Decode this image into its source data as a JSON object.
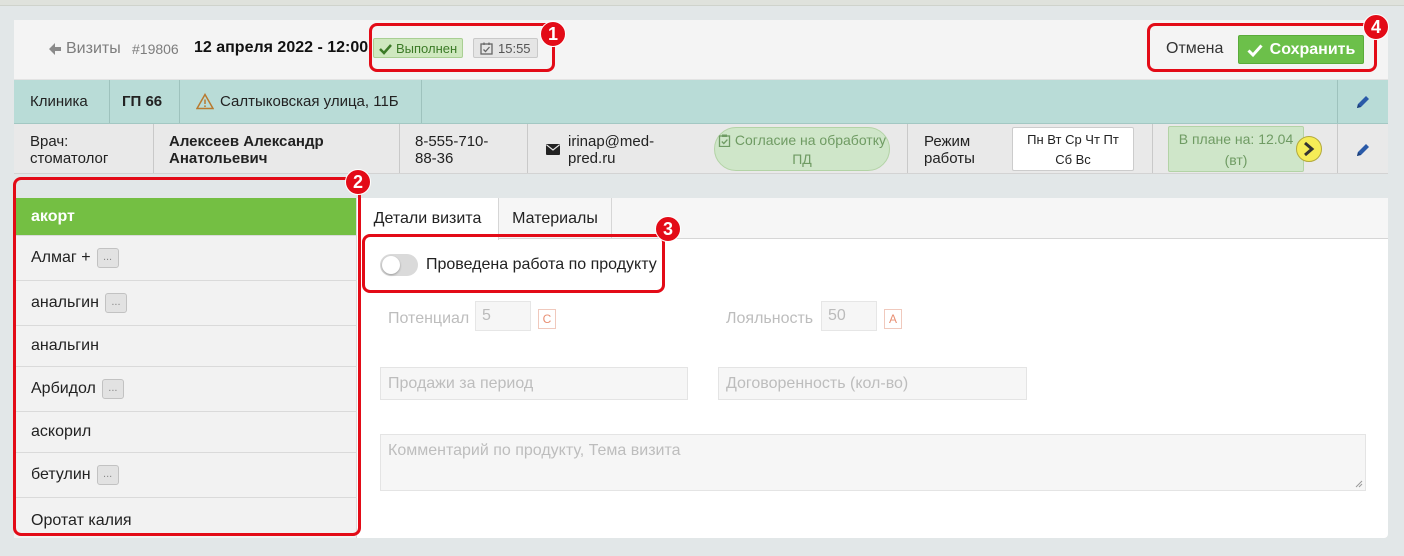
{
  "header": {
    "back_label": "Визиты",
    "visit_id": "#19806",
    "visit_date": "12 апреля 2022 - 12:00",
    "status": "Выполнен",
    "time": "15:55",
    "cancel_label": "Отмена",
    "save_label": "Сохранить"
  },
  "clinic": {
    "label": "Клиника",
    "name": "ГП 66",
    "address": "Салтыковская улица, 11Б"
  },
  "doctor": {
    "role": "Врач: стоматолог",
    "name": "Алексеев Александр Анатольевич",
    "phone": "8-555-710-88-36",
    "email": "irinap@med-pred.ru",
    "consent_label": "Согласие на обработку ПД",
    "schedule_label": "Режим работы",
    "days_line1": "Пн Вт Ср Чт Пт",
    "days_line2": "Сб Вс",
    "plan_label": "В плане на: 12.04",
    "plan_day": "(вт)"
  },
  "products": [
    {
      "name": "акорт",
      "dots": ""
    },
    {
      "name": "Алмаг +",
      "dots": "..."
    },
    {
      "name": "анальгин",
      "dots": "..."
    },
    {
      "name": "анальгин",
      "dots": ""
    },
    {
      "name": "Арбидол",
      "dots": "..."
    },
    {
      "name": "аскорил",
      "dots": ""
    },
    {
      "name": "бетулин",
      "dots": "..."
    },
    {
      "name": "Оротат калия",
      "dots": ""
    }
  ],
  "tabs": {
    "details": "Детали визита",
    "materials": "Материалы"
  },
  "form": {
    "toggle_label": "Проведена работа по продукту",
    "potential_label": "Потенциал",
    "potential_value": "5",
    "potential_grade": "C",
    "loyalty_label": "Лояльность",
    "loyalty_value": "50",
    "loyalty_grade": "A",
    "sales_placeholder": "Продажи за период",
    "agreement_placeholder": "Договоренность (кол-во)",
    "comment_placeholder": "Комментарий по продукту, Тема визита"
  },
  "markers": [
    "1",
    "2",
    "3",
    "4"
  ],
  "colors": {
    "accent_green": "#74bf43",
    "annotation_red": "#e30b17",
    "clinic_bar": "#b9dcd7"
  }
}
